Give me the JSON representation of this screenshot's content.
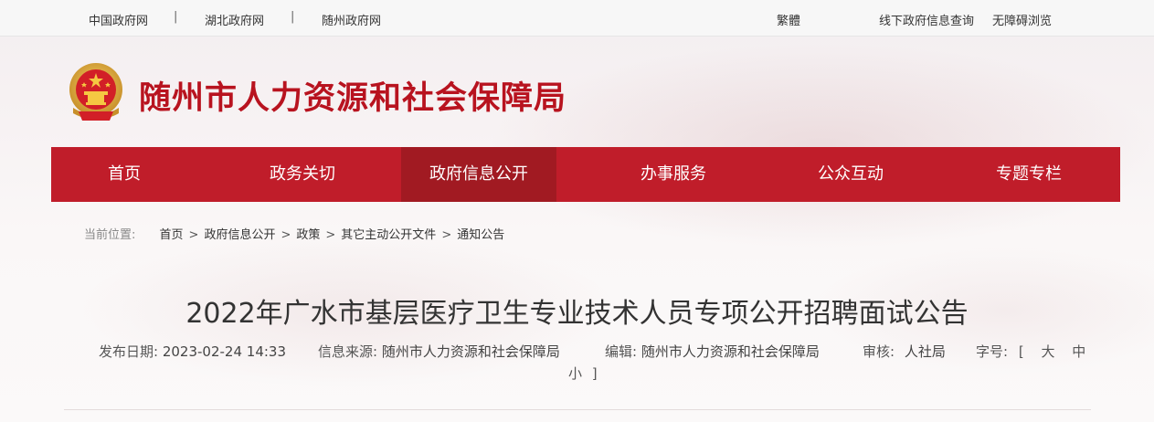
{
  "topbar": {
    "links": [
      "中国政府网",
      "湖北政府网",
      "随州政府网"
    ],
    "separator": "|",
    "traditional": "繁體",
    "offline_query": "线下政府信息查询",
    "accessibility": "无障碍浏览"
  },
  "header": {
    "site_title": "随州市人力资源和社会保障局",
    "emblem_icon": "national-emblem-icon"
  },
  "nav": {
    "items": [
      "首页",
      "政务关切",
      "政府信息公开",
      "办事服务",
      "公众互动",
      "专题专栏"
    ],
    "active_index": 2,
    "color": "#c01d2a",
    "active_color": "#a11a22"
  },
  "breadcrumb": {
    "label": "当前位置:",
    "separator": ">",
    "items": [
      "首页",
      "政府信息公开",
      "政策",
      "其它主动公开文件",
      "通知公告"
    ]
  },
  "article": {
    "title": "2022年广水市基层医疗卫生专业技术人员专项公开招聘面试公告",
    "publish_label": "发布日期:",
    "publish_value": "2023-02-24 14:33",
    "source_label": "信息来源:",
    "source_value": "随州市人力资源和社会保障局",
    "editor_label": "编辑:",
    "editor_value": "随州市人力资源和社会保障局",
    "review_label": "审核:",
    "review_value": "人社局",
    "fontsize_label": "字号:",
    "fontsize_open": "[",
    "fontsize_large": "大",
    "fontsize_medium": "中",
    "fontsize_small": "小",
    "fontsize_close": "]"
  }
}
